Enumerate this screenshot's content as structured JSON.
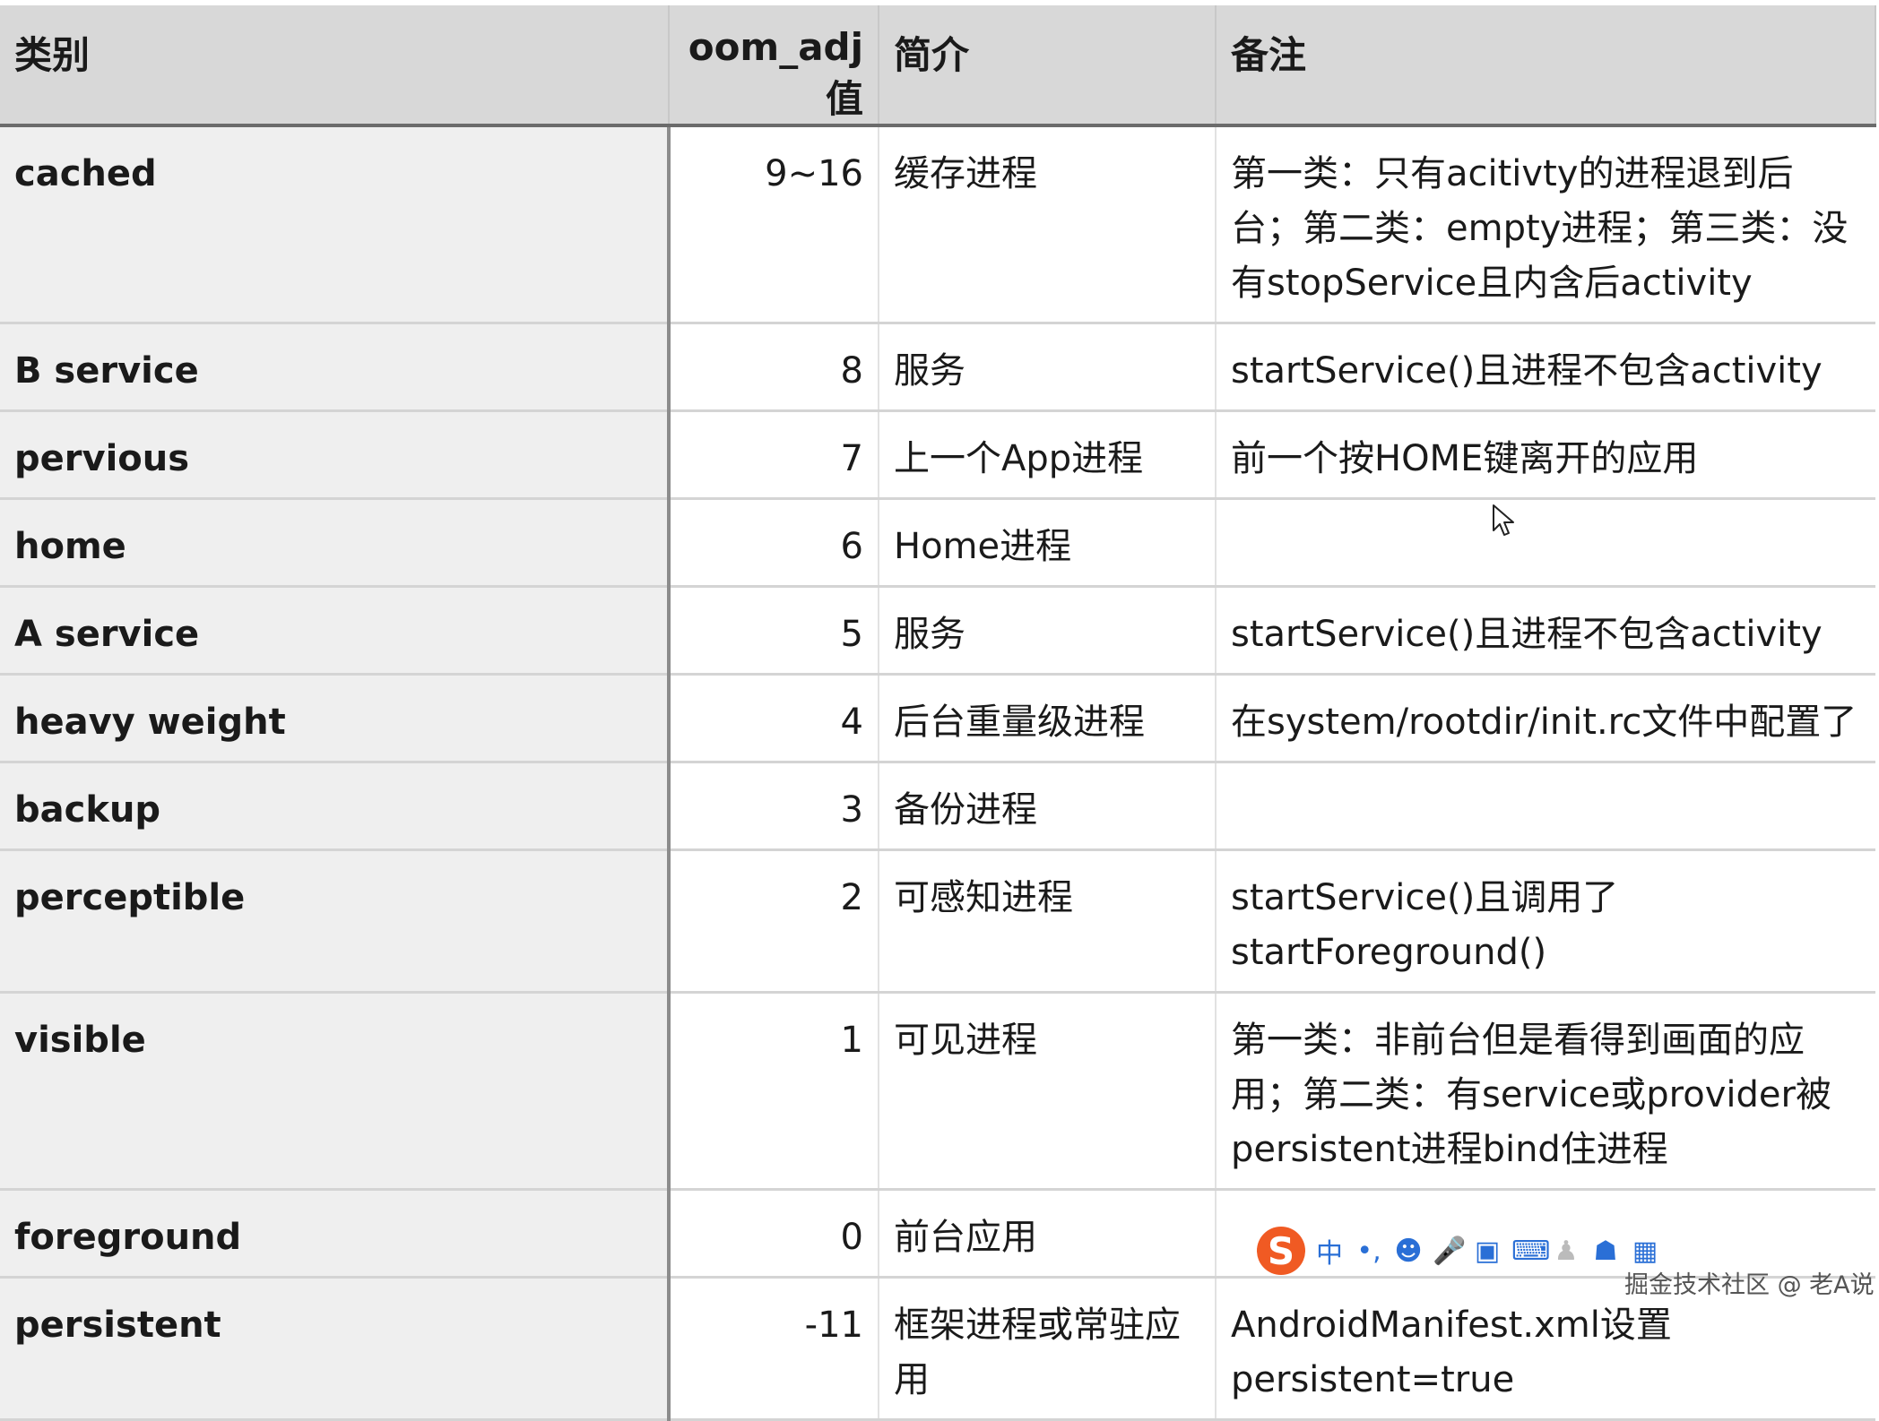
{
  "headers": {
    "category": "类别",
    "oom_adj": "oom_adj值",
    "desc": "简介",
    "note": "备注"
  },
  "rows": [
    {
      "category": "cached",
      "oom_adj": "9~16",
      "desc": "缓存进程",
      "note": "第一类：只有acitivty的进程退到后台；第二类：empty进程；第三类：没有stopService且内含后activity"
    },
    {
      "category": "B service",
      "oom_adj": "8",
      "desc": "服务",
      "note": "startService()且进程不包含activity"
    },
    {
      "category": "pervious",
      "oom_adj": "7",
      "desc": "上一个App进程",
      "note": "前一个按HOME键离开的应用"
    },
    {
      "category": "home",
      "oom_adj": "6",
      "desc": "Home进程",
      "note": ""
    },
    {
      "category": "A service",
      "oom_adj": "5",
      "desc": "服务",
      "note": "startService()且进程不包含activity"
    },
    {
      "category": "heavy weight",
      "oom_adj": "4",
      "desc": "后台重量级进程",
      "note": "在system/rootdir/init.rc文件中配置了"
    },
    {
      "category": "backup",
      "oom_adj": "3",
      "desc": "备份进程",
      "note": ""
    },
    {
      "category": "perceptible",
      "oom_adj": "2",
      "desc": "可感知进程",
      "note": "startService()且调用了startForeground()"
    },
    {
      "category": "visible",
      "oom_adj": "1",
      "desc": "可见进程",
      "note": "第一类：非前台但是看得到画面的应用；第二类：有service或provider被persistent进程bind住进程"
    },
    {
      "category": "foreground",
      "oom_adj": "0",
      "desc": "前台应用",
      "note": ""
    },
    {
      "category": "persistent",
      "oom_adj": "-11",
      "desc": "框架进程或常驻应用",
      "note": "AndroidManifest.xml设置persistent=true"
    }
  ],
  "ime_toolbar": {
    "logo": "S",
    "mode_label": "中",
    "punct_label": "•,",
    "icons": [
      "emoji-icon",
      "microphone-icon",
      "clipboard-icon",
      "keyboard-icon",
      "user-icon",
      "skin-icon",
      "apps-grid-icon"
    ]
  },
  "watermark": "掘金技术社区 @ 老A说"
}
